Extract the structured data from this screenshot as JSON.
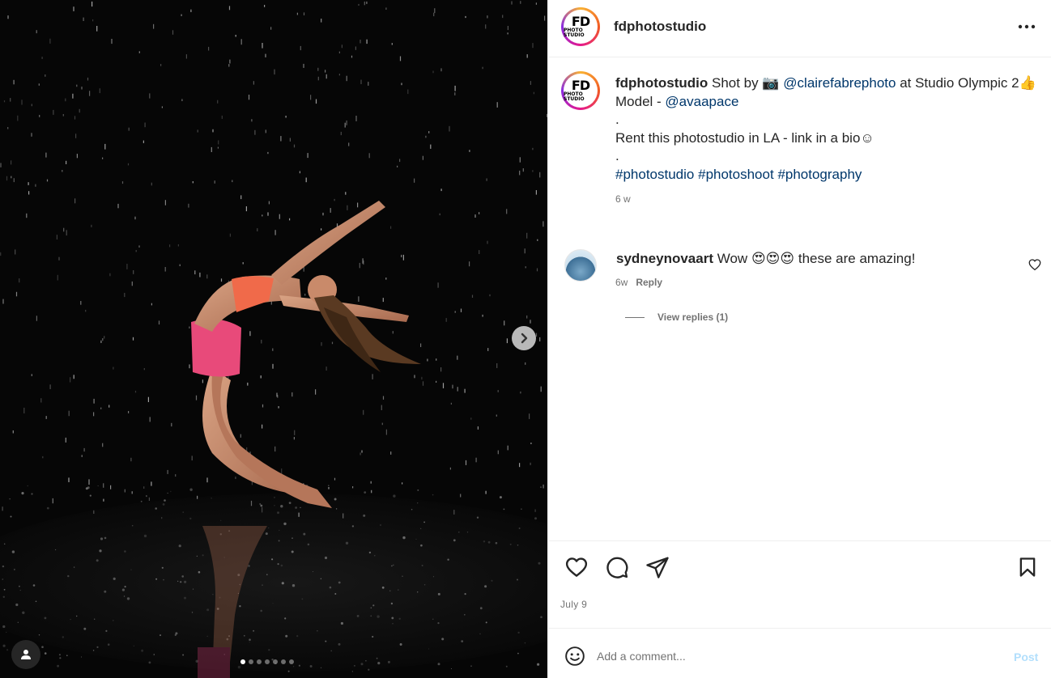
{
  "post": {
    "username": "fdphotostudio",
    "avatar_text": {
      "main": "FD",
      "sub": "PHOTO STUDIO"
    },
    "caption": {
      "intro": "Shot by",
      "camera_glyph": "📷",
      "photographer": "@clairefabrephoto",
      "location_text": "at Studio Olympic 2",
      "thumb_glyph": "👍",
      "model_label": "Model -",
      "model_handle": "@avaapace",
      "dot1": ".",
      "rent_text": "Rent this photostudio in LA - link in a bio☺",
      "dot2": ".",
      "hashtags": [
        "#photostudio",
        "#photoshoot",
        "#photography"
      ],
      "age": "6 w"
    },
    "date": "July  9"
  },
  "comment": {
    "username": "sydneynovaart",
    "text_start": "Wow",
    "emojis": "😍😍😍",
    "text_end": "these are amazing!",
    "age": "6w",
    "reply_label": "Reply",
    "view_replies": "View replies (1)"
  },
  "composer": {
    "placeholder": "Add a comment...",
    "post_label": "Post"
  },
  "media": {
    "slide_count": 7,
    "active_slide": 0,
    "icons": [
      "chevron-right-icon",
      "user-tag-icon"
    ]
  },
  "colors": {
    "link": "#00376b",
    "post_disabled": "#b2dffc",
    "outfit": "#e84a7a"
  }
}
